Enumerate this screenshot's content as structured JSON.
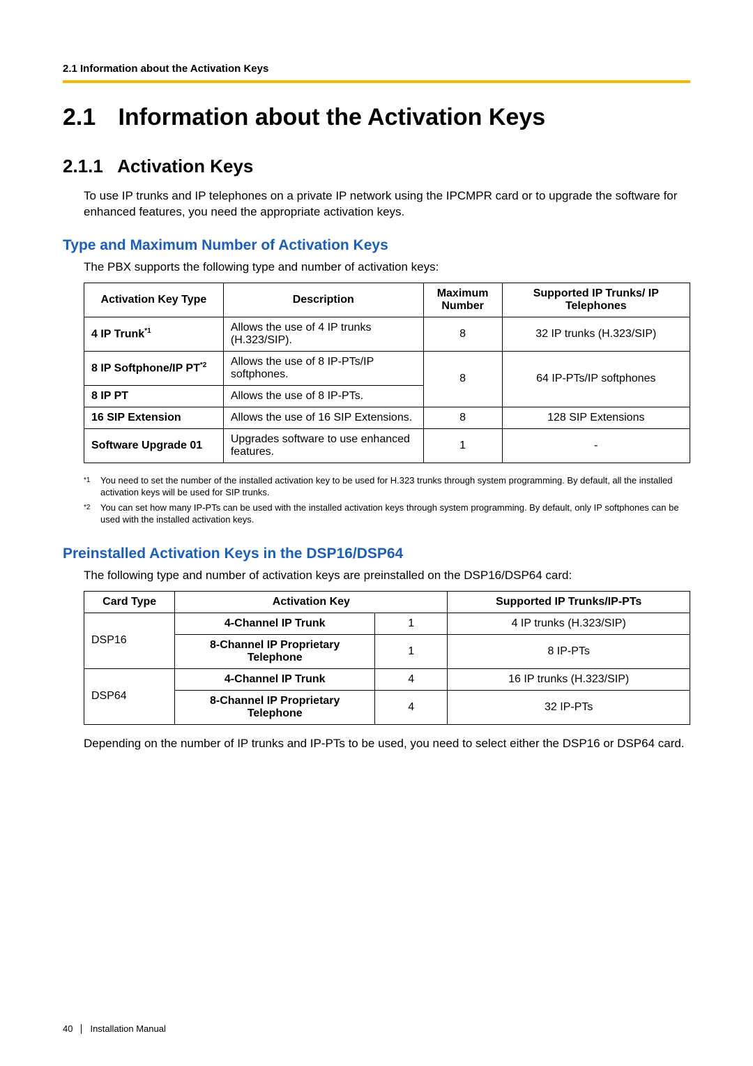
{
  "running_head": "2.1 Information about the Activation Keys",
  "h1_num": "2.1",
  "h1_title": "Information about the Activation Keys",
  "h2_num": "2.1.1",
  "h2_title": "Activation Keys",
  "intro_para": "To use IP trunks and IP telephones on a private IP network using the IPCMPR card or to upgrade the software for enhanced features, you need the appropriate activation keys.",
  "blue1": "Type and Maximum Number of Activation Keys",
  "blue1_intro": "The PBX supports the following type and number of activation keys:",
  "table1": {
    "headers": {
      "c1": "Activation Key Type",
      "c2": "Description",
      "c3": "Maximum Number",
      "c4": "Supported IP Trunks/ IP Telephones"
    },
    "row1": {
      "type": "4 IP Trunk",
      "type_sup": "*1",
      "desc": "Allows the use of 4 IP trunks (H.323/SIP).",
      "max": "8",
      "supp": "32 IP trunks (H.323/SIP)"
    },
    "row2a": {
      "type": "8 IP Softphone/IP PT",
      "type_sup": "*2",
      "desc": "Allows the use of 8 IP-PTs/IP softphones."
    },
    "row2_shared_max": "8",
    "row2_shared_supp": "64 IP-PTs/IP softphones",
    "row2b": {
      "type": "8 IP PT",
      "desc": "Allows the use of 8 IP-PTs."
    },
    "row3": {
      "type": "16 SIP Extension",
      "desc": "Allows the use of 16 SIP Extensions.",
      "max": "8",
      "supp": "128 SIP Extensions"
    },
    "row4": {
      "type": "Software Upgrade 01",
      "desc": "Upgrades software to use enhanced features.",
      "max": "1",
      "supp": "-"
    }
  },
  "footnote1_mark": "*1",
  "footnote1": "You need to set the number of the installed activation key to be used for H.323 trunks through system programming. By default, all the installed activation keys will be used for SIP trunks.",
  "footnote2_mark": "*2",
  "footnote2": "You can set how many IP-PTs can be used with the installed activation keys through system programming. By default, only IP softphones can be used with the installed activation keys.",
  "blue2": "Preinstalled Activation Keys in the DSP16/DSP64",
  "blue2_intro": "The following type and number of activation keys are preinstalled on the DSP16/DSP64 card:",
  "table2": {
    "headers": {
      "c1": "Card Type",
      "c2": "Activation Key",
      "c3_blank": "",
      "c4": "Supported IP Trunks/IP-PTs"
    },
    "dsp16": {
      "label": "DSP16",
      "r1_key": "4-Channel IP Trunk",
      "r1_n": "1",
      "r1_supp": "4 IP trunks (H.323/SIP)",
      "r2_key": "8-Channel IP Proprietary Telephone",
      "r2_n": "1",
      "r2_supp": "8 IP-PTs"
    },
    "dsp64": {
      "label": "DSP64",
      "r1_key": "4-Channel IP Trunk",
      "r1_n": "4",
      "r1_supp": "16 IP trunks (H.323/SIP)",
      "r2_key": "8-Channel IP Proprietary Telephone",
      "r2_n": "4",
      "r2_supp": "32 IP-PTs"
    }
  },
  "after_table2": "Depending on the number of IP trunks and IP-PTs to be used, you need to select either the DSP16 or DSP64 card.",
  "page_number": "40",
  "manual_name": "Installation Manual"
}
